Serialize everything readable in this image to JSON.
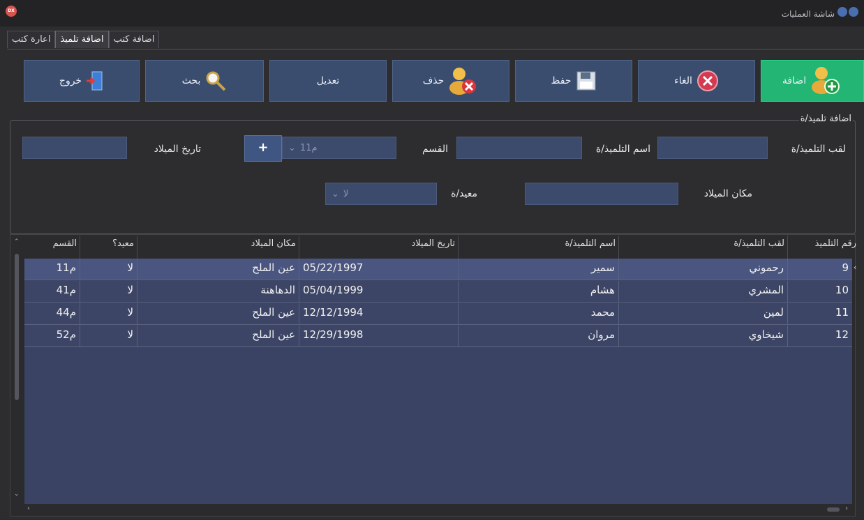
{
  "window": {
    "title": "شاشة العمليات",
    "app_badge": "DX"
  },
  "tabs": [
    {
      "label": "اعارة كتب"
    },
    {
      "label": "اضافة تلميذ"
    },
    {
      "label": "اضافة كتب"
    }
  ],
  "toolbar": {
    "add": "اضافة",
    "cancel": "الغاء",
    "save": "حفظ",
    "delete": "حذف",
    "edit": "تعديل",
    "search": "بحث",
    "exit": "خروج"
  },
  "form": {
    "legend": "اضافة تلميذ/ة",
    "surname_label": "لقب التلميذ/ة",
    "surname_value": "",
    "name_label": "اسم التلميذ/ة",
    "name_value": "",
    "section_label": "القسم",
    "section_value": "1م1",
    "plus_label": "+",
    "birthdate_label": "تاريخ الميلاد",
    "birthdate_value": "",
    "birthplace_label": "مكان الميلاد",
    "birthplace_value": "",
    "repeat_label": "معيد/ة",
    "repeat_value": "لا"
  },
  "grid": {
    "columns": [
      "رقم التلميذ",
      "لقب التلميذ/ة",
      "اسم التلميذ/ة",
      "تاريخ الميلاد",
      "مكان الميلاد",
      "معيد؟",
      "القسم"
    ],
    "rows": [
      {
        "id": "9",
        "surname": "رحموني",
        "name": "سمير",
        "birthdate": "05/22/1997",
        "birthplace": "عين الملح",
        "repeat": "لا",
        "section": "1م1"
      },
      {
        "id": "10",
        "surname": "المشري",
        "name": "هشام",
        "birthdate": "05/04/1999",
        "birthplace": "الدهاهنة",
        "repeat": "لا",
        "section": "4م1"
      },
      {
        "id": "11",
        "surname": "لمين",
        "name": "محمد",
        "birthdate": "12/12/1994",
        "birthplace": "عين الملح",
        "repeat": "لا",
        "section": "4م4"
      },
      {
        "id": "12",
        "surname": "شيخاوي",
        "name": "مروان",
        "birthdate": "12/29/1998",
        "birthplace": "عين الملح",
        "repeat": "لا",
        "section": "5م2"
      }
    ]
  },
  "colors": {
    "accent_green": "#22b573",
    "button_blue": "#3a4d6e",
    "grid_row": "#3c4565"
  }
}
